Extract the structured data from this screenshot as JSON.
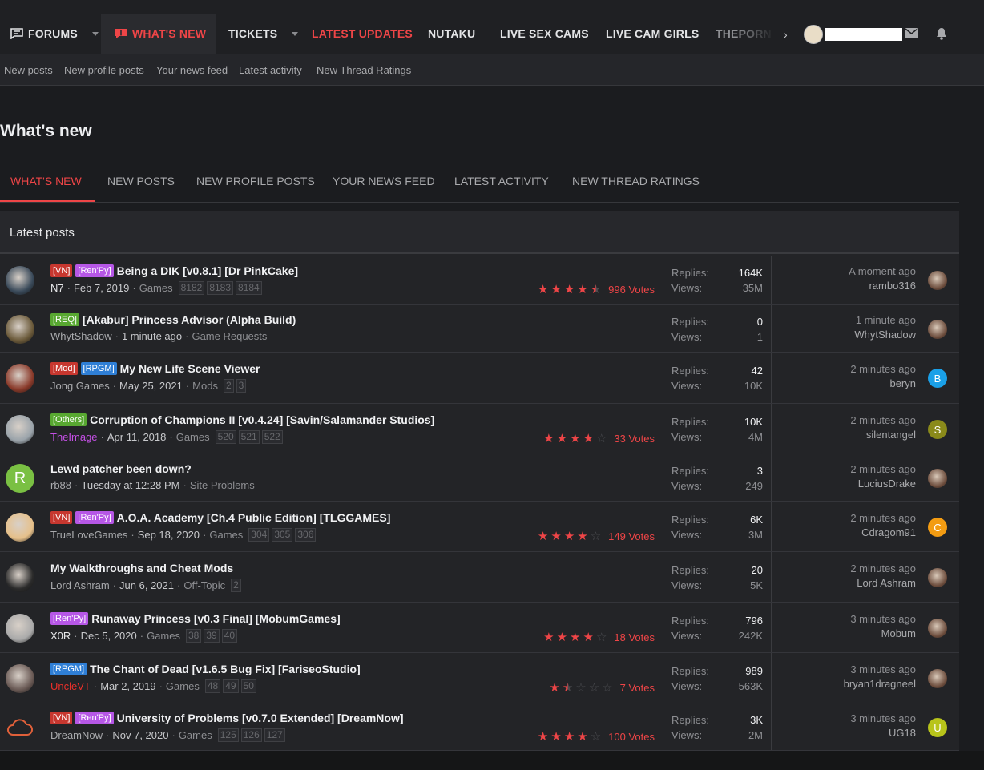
{
  "topnav": {
    "forums": "FORUMS",
    "whats_new": "WHAT'S NEW",
    "tickets": "TICKETS",
    "latest_updates": "LATEST UPDATES",
    "nutaku": "NUTAKU",
    "live_sex_cams": "LIVE SEX CAMS",
    "live_cam_girls": "LIVE CAM GIRLS",
    "theporn": "THEPORN"
  },
  "subnav": [
    "New posts",
    "New profile posts",
    "Your news feed",
    "Latest activity",
    "New Thread Ratings"
  ],
  "page_title": "What's new",
  "tabs": [
    "WHAT'S NEW",
    "NEW POSTS",
    "NEW PROFILE POSTS",
    "YOUR NEWS FEED",
    "LATEST ACTIVITY",
    "NEW THREAD RATINGS"
  ],
  "block_title": "Latest posts",
  "stat_labels": {
    "replies": "Replies:",
    "views": "Views:"
  },
  "colors": {
    "accent": "#ee4547",
    "bg": "#1b1c1f"
  },
  "threads": [
    {
      "labels": [
        "[VN]",
        "[Ren'Py]"
      ],
      "title": "Being a DIK [v0.8.1] [Dr PinkCake]",
      "author": "N7",
      "date": "Feb 7, 2019",
      "forum": "Games",
      "pages": [
        "8182",
        "8183",
        "8184"
      ],
      "rating": 4.5,
      "votes": "996 Votes",
      "replies": "164K",
      "views": "35M",
      "last_time": "A moment ago",
      "last_user": "rambo316",
      "last_avatar": ""
    },
    {
      "labels": [
        "[REQ]"
      ],
      "title": "[Akabur] Princess Advisor (Alpha Build)",
      "author": "WhytShadow",
      "date": "1 minute ago",
      "forum": "Game Requests",
      "pages": [],
      "rating": 0,
      "votes": "",
      "replies": "0",
      "views": "1",
      "last_time": "1 minute ago",
      "last_user": "WhytShadow",
      "last_avatar": ""
    },
    {
      "labels": [
        "[Mod]",
        "[RPGM]"
      ],
      "title": "My New Life Scene Viewer",
      "author": "Jong Games",
      "date": "May 25, 2021",
      "forum": "Mods",
      "pages": [
        "2",
        "3"
      ],
      "rating": 0,
      "votes": "",
      "replies": "42",
      "views": "10K",
      "last_time": "2 minutes ago",
      "last_user": "beryn",
      "last_avatar": "B"
    },
    {
      "labels": [
        "[Others]"
      ],
      "title": "Corruption of Champions II [v0.4.24] [Savin/Salamander Studios]",
      "author": "TheImage",
      "date": "Apr 11, 2018",
      "forum": "Games",
      "pages": [
        "520",
        "521",
        "522"
      ],
      "rating": 4,
      "votes": "33 Votes",
      "replies": "10K",
      "views": "4M",
      "last_time": "2 minutes ago",
      "last_user": "silentangel",
      "last_avatar": "S"
    },
    {
      "labels": [],
      "title": "Lewd patcher been down?",
      "author": "rb88",
      "date": "Tuesday at 12:28 PM",
      "forum": "Site Problems",
      "pages": [],
      "rating": 0,
      "votes": "",
      "replies": "3",
      "views": "249",
      "last_time": "2 minutes ago",
      "last_user": "LuciusDrake",
      "last_avatar": ""
    },
    {
      "labels": [
        "[VN]",
        "[Ren'Py]"
      ],
      "title": "A.O.A. Academy [Ch.4 Public Edition] [TLGGAMES]",
      "author": "TrueLoveGames",
      "date": "Sep 18, 2020",
      "forum": "Games",
      "pages": [
        "304",
        "305",
        "306"
      ],
      "rating": 4,
      "votes": "149 Votes",
      "replies": "6K",
      "views": "3M",
      "last_time": "2 minutes ago",
      "last_user": "Cdragom91",
      "last_avatar": "C"
    },
    {
      "labels": [],
      "title": "My Walkthroughs and Cheat Mods",
      "author": "Lord Ashram",
      "date": "Jun 6, 2021",
      "forum": "Off-Topic",
      "pages": [
        "2"
      ],
      "rating": 0,
      "votes": "",
      "replies": "20",
      "views": "5K",
      "last_time": "2 minutes ago",
      "last_user": "Lord Ashram",
      "last_avatar": ""
    },
    {
      "labels": [
        "[Ren'Py]"
      ],
      "title": "Runaway Princess [v0.3 Final] [MobumGames]",
      "author": "X0R",
      "date": "Dec 5, 2020",
      "forum": "Games",
      "pages": [
        "38",
        "39",
        "40"
      ],
      "rating": 4,
      "votes": "18 Votes",
      "replies": "796",
      "views": "242K",
      "last_time": "3 minutes ago",
      "last_user": "Mobum",
      "last_avatar": ""
    },
    {
      "labels": [
        "[RPGM]"
      ],
      "title": "The Chant of Dead [v1.6.5 Bug Fix] [FariseoStudio]",
      "author": "UncleVT",
      "date": "Mar 2, 2019",
      "forum": "Games",
      "pages": [
        "48",
        "49",
        "50"
      ],
      "rating": 1.5,
      "votes": "7 Votes",
      "replies": "989",
      "views": "563K",
      "last_time": "3 minutes ago",
      "last_user": "bryan1dragneel",
      "last_avatar": ""
    },
    {
      "labels": [
        "[VN]",
        "[Ren'Py]"
      ],
      "title": "University of Problems [v0.7.0 Extended] [DreamNow]",
      "author": "DreamNow",
      "date": "Nov 7, 2020",
      "forum": "Games",
      "pages": [
        "125",
        "126",
        "127"
      ],
      "rating": 4,
      "votes": "100 Votes",
      "replies": "3K",
      "views": "2M",
      "last_time": "3 minutes ago",
      "last_user": "UG18",
      "last_avatar": "U"
    }
  ]
}
